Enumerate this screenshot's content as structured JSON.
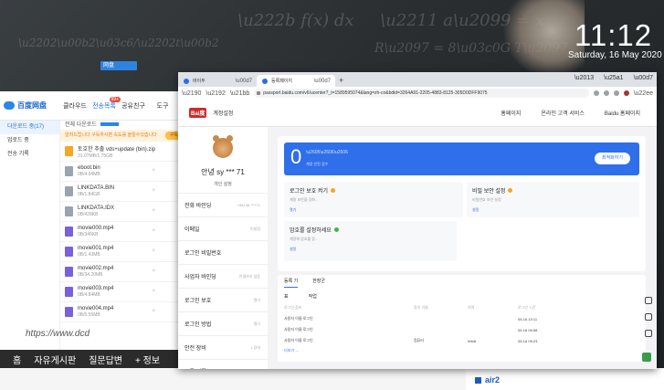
{
  "desktop": {
    "clock": "11:12",
    "date": "Saturday, 16 May 2020",
    "tray_label": "网盘"
  },
  "pan": {
    "logo": "百度网盘",
    "nav": [
      "클라우드",
      "전송목록",
      "공유친구",
      "도구"
    ],
    "nav_badge": "99+",
    "side": [
      "다운로드 중(17)",
      "업로드 중",
      "전송 기록"
    ],
    "head": "전체 다운로드",
    "notice": "알려드립니다 구독하시면 속도를 올릴수있습니다",
    "notice_btn": "구독",
    "files": [
      {
        "name": "토호한 추출 vds+update (bin).zip",
        "size": "31.07MB/1.75GB",
        "color": "#f5a623"
      },
      {
        "name": "eboot.bin",
        "size": "0B/4.94MB",
        "color": "#9aa3b0"
      },
      {
        "name": "LINKDATA.BIN",
        "size": "0B/1.84GB",
        "color": "#9aa3b0"
      },
      {
        "name": "LINKDATA.IDX",
        "size": "0B/428KB",
        "color": "#9aa3b0"
      },
      {
        "name": "movie000.mp4",
        "size": "0B/345KB",
        "color": "#7b61d9"
      },
      {
        "name": "movie001.mp4",
        "size": "0B/1.43MB",
        "color": "#7b61d9"
      },
      {
        "name": "movie002.mp4",
        "size": "0B/34.20MB",
        "color": "#7b61d9"
      },
      {
        "name": "movie003.mp4",
        "size": "0B/4.84MB",
        "color": "#7b61d9"
      },
      {
        "name": "movie004.mp4",
        "size": "0B/5.55MB",
        "color": "#7b61d9"
      }
    ]
  },
  "korean": {
    "url": "https://www.dcd",
    "nav": [
      "홈",
      "자유게시판",
      "질문답변",
      "+ 정보"
    ]
  },
  "air2": "air2",
  "chrome": {
    "tabs": [
      "바이두",
      "등록페이지"
    ],
    "url": "passport.baidu.com/v6/ucenter?_t=1589595074&lang=zh-cn&bdid=3264A91-2205-4883-8125-305D0DFF9075"
  },
  "page": {
    "logo_badge": "Bai度",
    "logo_text": "계정설정",
    "links": [
      "홈페이지",
      "온라인 고객 서비스",
      "Baidu 홈페이지"
    ],
    "user": "안녕 sy *** 71",
    "user_sub": "개인 설정",
    "menu": [
      {
        "label": "전화 바인딩",
        "value": "+86138 ****71"
      },
      {
        "label": "이메일",
        "value": "미설정"
      },
      {
        "label": "로그인 비밀번호",
        "value": ""
      },
      {
        "label": "사업자 바인딩",
        "value": "연결하지 않음"
      },
      {
        "label": "로그인 보호",
        "value": "열기"
      },
      {
        "label": "로그인 방법",
        "value": "열기"
      },
      {
        "label": "안전 장비",
        "value": "1 장비"
      },
      {
        "label": "등록 기록",
        "value": ""
      }
    ],
    "score": "0",
    "score_label": "계정 안전 점수",
    "score_btn": "최적화하기",
    "cards": [
      {
        "title": "로그인 보호 켜기",
        "desc": "계정 보안을 강화...",
        "link": "열기",
        "dot": "#f5a623"
      },
      {
        "title": "비밀 보안 설정",
        "desc": "비밀번호 보안 설정",
        "link": "설정",
        "dot": "#f5a623"
      },
      {
        "title": "암호를 설정하세요",
        "desc": "계정에 암호를 등...",
        "link": "설정",
        "dot": "#4caf50"
      }
    ],
    "hist_tabs": [
      "등록 기",
      "한장군"
    ],
    "hist_header": [
      "로그인 장비",
      "장치 이름",
      "지역",
      "로그인 시간"
    ],
    "hist_col1": "표",
    "hist_col2": "작업",
    "hist_rows": [
      {
        "user": "사용자 이름 로그인",
        "device": "",
        "os": "",
        "time": "05-16 10:11"
      },
      {
        "user": "사용자 이름 로그인",
        "device": "",
        "os": "",
        "time": "05-16 09:58"
      },
      {
        "user": "사용자 이름 로그인",
        "device": "컴퓨터",
        "os": "Win8",
        "time": "05-16 09:23"
      }
    ],
    "hist_more": "더보기 →"
  }
}
